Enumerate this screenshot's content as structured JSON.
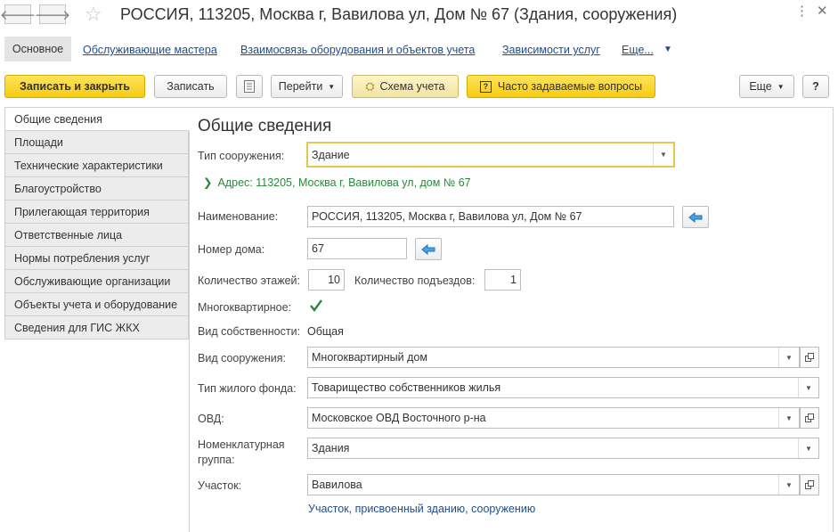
{
  "window": {
    "title": "РОССИЯ, 113205, Москва г, Вавилова ул, Дом № 67 (Здания, сооружения)",
    "back_icon": "arrow-left-icon",
    "forward_icon": "arrow-right-icon",
    "favorite_icon": "star-icon",
    "menu_icon": "kebab-icon",
    "close_icon": "close-icon"
  },
  "tabs": {
    "main": "Основное",
    "links": [
      "Обслуживающие мастера",
      "Взаимосвязь оборудования и объектов учета",
      "Зависимости услуг",
      "Еще..."
    ]
  },
  "toolbar": {
    "save_close": "Записать и закрыть",
    "save": "Записать",
    "goto": "Перейти",
    "scheme": "Схема учета",
    "faq": "Часто задаваемые вопросы",
    "more": "Еще",
    "help": "?"
  },
  "nav": {
    "items": [
      "Общие сведения",
      "Площади",
      "Технические характеристики",
      "Благоустройство",
      "Прилегающая территория",
      "Ответственные лица",
      "Нормы потребления услуг",
      "Обслуживающие организации",
      "Объекты учета и оборудование",
      "Сведения для ГИС ЖКХ"
    ]
  },
  "form": {
    "heading": "Общие сведения",
    "structure_type_label": "Тип сооружения:",
    "structure_type_value": "Здание",
    "address_link": "Адрес: 113205, Москва г, Вавилова ул, дом № 67",
    "name_label": "Наименование:",
    "name_value": "РОССИЯ, 113205, Москва г, Вавилова ул, Дом № 67",
    "house_label": "Номер дома:",
    "house_value": "67",
    "floors_label": "Количество этажей:",
    "floors_value": "10",
    "entrances_label": "Количество подъездов:",
    "entrances_value": "1",
    "apartment_label": "Многоквартирное:",
    "apartment_checked": true,
    "ownership_label": "Вид собственности:",
    "ownership_value": "Общая",
    "kind_label": "Вид сооружения:",
    "kind_value": "Многоквартирный дом",
    "fund_label": "Тип жилого фонда:",
    "fund_value": "Товарищество собственников жилья",
    "ovd_label": "ОВД:",
    "ovd_value": "Московское ОВД Восточного р-на",
    "nomen_label_1": "Номенклатурная",
    "nomen_label_2": "группа:",
    "nomen_value": "Здания",
    "plot_label": "Участок:",
    "plot_value": "Вавилова",
    "plot_link": "Участок, присвоенный зданию, сооружению"
  },
  "colors": {
    "accent_yellow": "#f5cb11",
    "link_blue": "#1e4d8c",
    "green": "#2a8a3a",
    "focus_border": "#e8c64a"
  }
}
